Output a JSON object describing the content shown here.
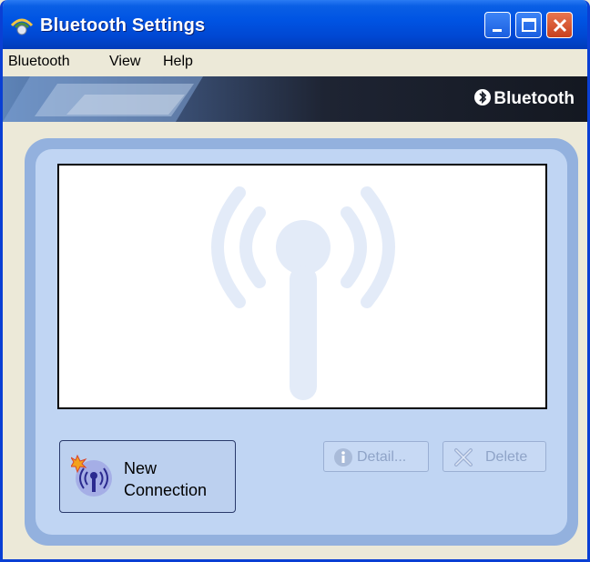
{
  "window": {
    "title": "Bluetooth Settings"
  },
  "menu": {
    "items": [
      "Bluetooth",
      "View",
      "Help"
    ]
  },
  "banner": {
    "brand": "Bluetooth"
  },
  "buttons": {
    "new_connection_line1": "New",
    "new_connection_line2": "Connection",
    "detail": "Detail...",
    "delete": "Delete"
  },
  "colors": {
    "title_bar": "#0054e3",
    "panel_outer": "#93b1de",
    "panel_inner": "#c0d5f3",
    "watermark": "#e3ebf8",
    "close_button": "#d85a32"
  },
  "icons": [
    "bluetooth-app-icon",
    "minimize-icon",
    "maximize-icon",
    "close-icon",
    "bluetooth-logo-icon",
    "antenna-watermark-icon",
    "new-connection-icon",
    "info-icon",
    "delete-x-icon"
  ]
}
